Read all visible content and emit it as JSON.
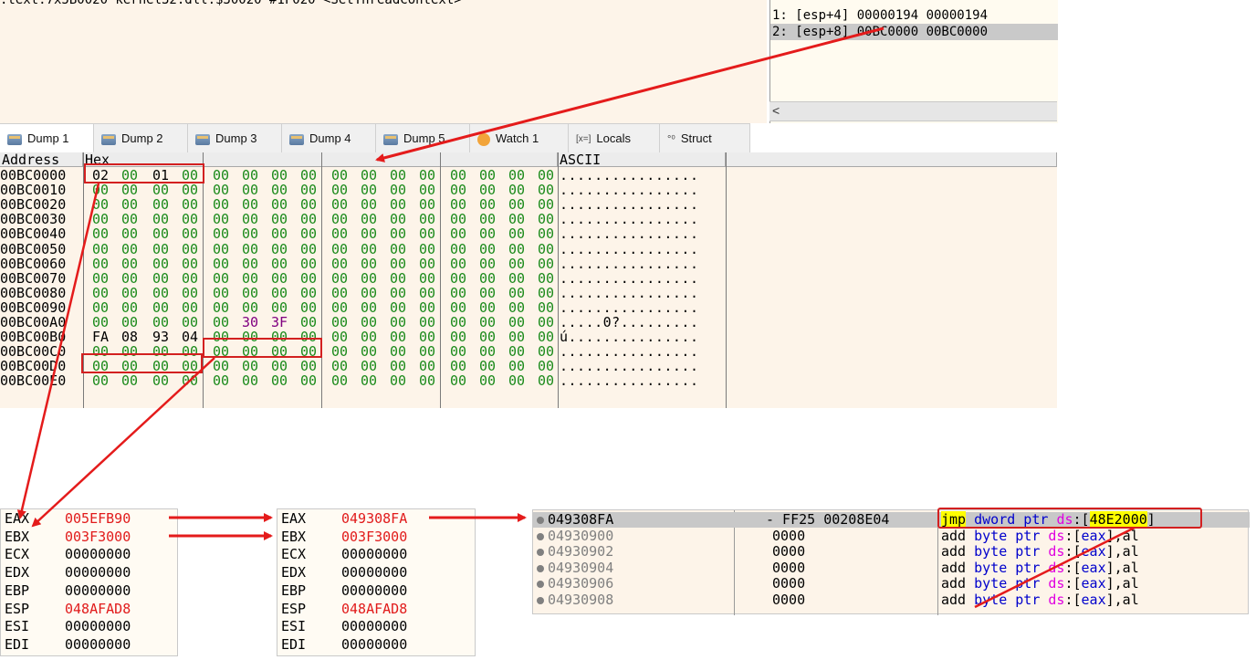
{
  "top_line": ".text:7x5B0020 kernel32.dll.$30020 #1F020 <SetThreadContext>",
  "stack": {
    "rows": [
      "1: [esp+4] 00000194 00000194",
      "2: [esp+8] 00BC0000 00BC0000"
    ],
    "scroll_left": "<"
  },
  "tabs": [
    {
      "label": "Dump 1",
      "icon": "dump-icon"
    },
    {
      "label": "Dump 2",
      "icon": "dump-icon"
    },
    {
      "label": "Dump 3",
      "icon": "dump-icon"
    },
    {
      "label": "Dump 4",
      "icon": "dump-icon"
    },
    {
      "label": "Dump 5",
      "icon": "dump-icon"
    },
    {
      "label": "Watch 1",
      "icon": "watch-icon"
    },
    {
      "label": "Locals",
      "icon": "locals-icon",
      "icon_text": "[x=]"
    },
    {
      "label": "Struct",
      "icon": "struct-icon",
      "icon_text": "°⁰"
    }
  ],
  "dump": {
    "headers": {
      "address": "Address",
      "hex": "Hex",
      "ascii": "ASCII"
    },
    "rows": [
      {
        "addr": "00BC0000",
        "bytes": [
          "02",
          "00",
          "01",
          "00",
          "00",
          "00",
          "00",
          "00",
          "00",
          "00",
          "00",
          "00",
          "00",
          "00",
          "00",
          "00"
        ],
        "ascii": "................"
      },
      {
        "addr": "00BC0010",
        "bytes": [
          "00",
          "00",
          "00",
          "00",
          "00",
          "00",
          "00",
          "00",
          "00",
          "00",
          "00",
          "00",
          "00",
          "00",
          "00",
          "00"
        ],
        "ascii": "................"
      },
      {
        "addr": "00BC0020",
        "bytes": [
          "00",
          "00",
          "00",
          "00",
          "00",
          "00",
          "00",
          "00",
          "00",
          "00",
          "00",
          "00",
          "00",
          "00",
          "00",
          "00"
        ],
        "ascii": "................"
      },
      {
        "addr": "00BC0030",
        "bytes": [
          "00",
          "00",
          "00",
          "00",
          "00",
          "00",
          "00",
          "00",
          "00",
          "00",
          "00",
          "00",
          "00",
          "00",
          "00",
          "00"
        ],
        "ascii": "................"
      },
      {
        "addr": "00BC0040",
        "bytes": [
          "00",
          "00",
          "00",
          "00",
          "00",
          "00",
          "00",
          "00",
          "00",
          "00",
          "00",
          "00",
          "00",
          "00",
          "00",
          "00"
        ],
        "ascii": "................"
      },
      {
        "addr": "00BC0050",
        "bytes": [
          "00",
          "00",
          "00",
          "00",
          "00",
          "00",
          "00",
          "00",
          "00",
          "00",
          "00",
          "00",
          "00",
          "00",
          "00",
          "00"
        ],
        "ascii": "................"
      },
      {
        "addr": "00BC0060",
        "bytes": [
          "00",
          "00",
          "00",
          "00",
          "00",
          "00",
          "00",
          "00",
          "00",
          "00",
          "00",
          "00",
          "00",
          "00",
          "00",
          "00"
        ],
        "ascii": "................"
      },
      {
        "addr": "00BC0070",
        "bytes": [
          "00",
          "00",
          "00",
          "00",
          "00",
          "00",
          "00",
          "00",
          "00",
          "00",
          "00",
          "00",
          "00",
          "00",
          "00",
          "00"
        ],
        "ascii": "................"
      },
      {
        "addr": "00BC0080",
        "bytes": [
          "00",
          "00",
          "00",
          "00",
          "00",
          "00",
          "00",
          "00",
          "00",
          "00",
          "00",
          "00",
          "00",
          "00",
          "00",
          "00"
        ],
        "ascii": "................"
      },
      {
        "addr": "00BC0090",
        "bytes": [
          "00",
          "00",
          "00",
          "00",
          "00",
          "00",
          "00",
          "00",
          "00",
          "00",
          "00",
          "00",
          "00",
          "00",
          "00",
          "00"
        ],
        "ascii": "................"
      },
      {
        "addr": "00BC00A0",
        "bytes": [
          "00",
          "00",
          "00",
          "00",
          "00",
          "30",
          "3F",
          "00",
          "00",
          "00",
          "00",
          "00",
          "00",
          "00",
          "00",
          "00"
        ],
        "ascii": ".....0?........."
      },
      {
        "addr": "00BC00B0",
        "bytes": [
          "FA",
          "08",
          "93",
          "04",
          "00",
          "00",
          "00",
          "00",
          "00",
          "00",
          "00",
          "00",
          "00",
          "00",
          "00",
          "00"
        ],
        "ascii": "ú..............."
      },
      {
        "addr": "00BC00C0",
        "bytes": [
          "00",
          "00",
          "00",
          "00",
          "00",
          "00",
          "00",
          "00",
          "00",
          "00",
          "00",
          "00",
          "00",
          "00",
          "00",
          "00"
        ],
        "ascii": "................"
      },
      {
        "addr": "00BC00D0",
        "bytes": [
          "00",
          "00",
          "00",
          "00",
          "00",
          "00",
          "00",
          "00",
          "00",
          "00",
          "00",
          "00",
          "00",
          "00",
          "00",
          "00"
        ],
        "ascii": "................"
      },
      {
        "addr": "00BC00E0",
        "bytes": [
          "00",
          "00",
          "00",
          "00",
          "00",
          "00",
          "00",
          "00",
          "00",
          "00",
          "00",
          "00",
          "00",
          "00",
          "00",
          "00"
        ],
        "ascii": "................"
      }
    ]
  },
  "registers_before": [
    {
      "name": "EAX",
      "value": "005EFB90",
      "red": true
    },
    {
      "name": "EBX",
      "value": "003F3000",
      "red": true
    },
    {
      "name": "ECX",
      "value": "00000000",
      "red": false
    },
    {
      "name": "EDX",
      "value": "00000000",
      "red": false
    },
    {
      "name": "EBP",
      "value": "00000000",
      "red": false
    },
    {
      "name": "ESP",
      "value": "048AFAD8",
      "red": true
    },
    {
      "name": "ESI",
      "value": "00000000",
      "red": false
    },
    {
      "name": "EDI",
      "value": "00000000",
      "red": false
    }
  ],
  "registers_after": [
    {
      "name": "EAX",
      "value": "049308FA",
      "red": true
    },
    {
      "name": "EBX",
      "value": "003F3000",
      "red": true
    },
    {
      "name": "ECX",
      "value": "00000000",
      "red": false
    },
    {
      "name": "EDX",
      "value": "00000000",
      "red": false
    },
    {
      "name": "EBP",
      "value": "00000000",
      "red": false
    },
    {
      "name": "ESP",
      "value": "048AFAD8",
      "red": true
    },
    {
      "name": "ESI",
      "value": "00000000",
      "red": false
    },
    {
      "name": "EDI",
      "value": "00000000",
      "red": false
    }
  ],
  "disasm": [
    {
      "addr": "049308FA",
      "bytes": "- FF25 00208E04",
      "instr": "jmp dword ptr ds:[48E2000]",
      "selected": true
    },
    {
      "addr": "04930900",
      "bytes": "0000",
      "instr": "add byte ptr ds:[eax],al",
      "selected": false
    },
    {
      "addr": "04930902",
      "bytes": "0000",
      "instr": "add byte ptr ds:[eax],al",
      "selected": false
    },
    {
      "addr": "04930904",
      "bytes": "0000",
      "instr": "add byte ptr ds:[eax],al",
      "selected": false
    },
    {
      "addr": "04930906",
      "bytes": "0000",
      "instr": "add byte ptr ds:[eax],al",
      "selected": false
    },
    {
      "addr": "04930908",
      "bytes": "0000",
      "instr": "add byte ptr ds:[eax],al",
      "selected": false
    }
  ],
  "colors": {
    "highlight_box": "#d32020",
    "hex_zero": "#1a8a1a",
    "reg_changed": "#e11b1b",
    "arrow": "#e41b1b"
  }
}
